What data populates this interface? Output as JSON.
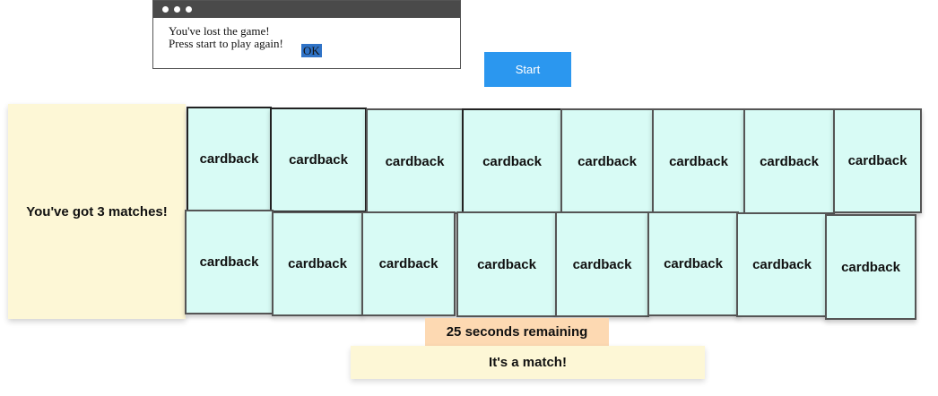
{
  "dialog": {
    "message": "You've lost the game! Press start to play again!",
    "ok_label": "OK"
  },
  "start_button": {
    "label": "Start"
  },
  "matches_panel": {
    "text": "You've got 3 matches!"
  },
  "cards": [
    {
      "label": "cardback"
    },
    {
      "label": "cardback"
    },
    {
      "label": "cardback"
    },
    {
      "label": "cardback"
    },
    {
      "label": "cardback"
    },
    {
      "label": "cardback"
    },
    {
      "label": "cardback"
    },
    {
      "label": "cardback"
    },
    {
      "label": "cardback"
    },
    {
      "label": "cardback"
    },
    {
      "label": "cardback"
    },
    {
      "label": "cardback"
    },
    {
      "label": "cardback"
    },
    {
      "label": "cardback"
    },
    {
      "label": "cardback"
    },
    {
      "label": "cardback"
    }
  ],
  "timer": {
    "text": "25 seconds remaining"
  },
  "status": {
    "text": "It's a match!"
  },
  "colors": {
    "start_button": "#2b97ef",
    "card_back": "#d8fbf5",
    "panel": "#fdf7d6",
    "timer": "#fdd9b2",
    "ok_highlight": "#2f73c7"
  }
}
